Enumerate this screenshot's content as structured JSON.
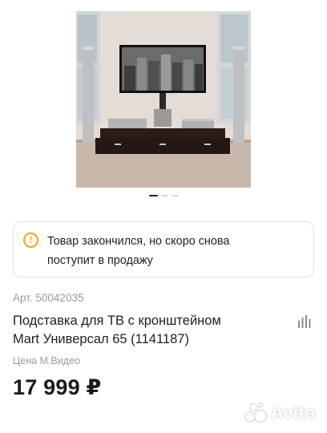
{
  "gallery": {
    "total_images": 3,
    "active_index": 0
  },
  "notice": {
    "icon": "warning-icon",
    "text_line1": "Товар закончился, но скоро снова",
    "text_line2": "поступит в продажу"
  },
  "product": {
    "sku": "Арт. 50042035",
    "title_line1": "Подставка для ТВ с кронштейном",
    "title_line2": "Mart Универсал 65 (1141187)",
    "price_label": "Цена М.Видео",
    "price": "17 999 ₽"
  },
  "watermark": {
    "brand": "Avito"
  },
  "colors": {
    "warning": "#f3a712",
    "text": "#1f1f1f",
    "muted": "#9a9a9a"
  }
}
